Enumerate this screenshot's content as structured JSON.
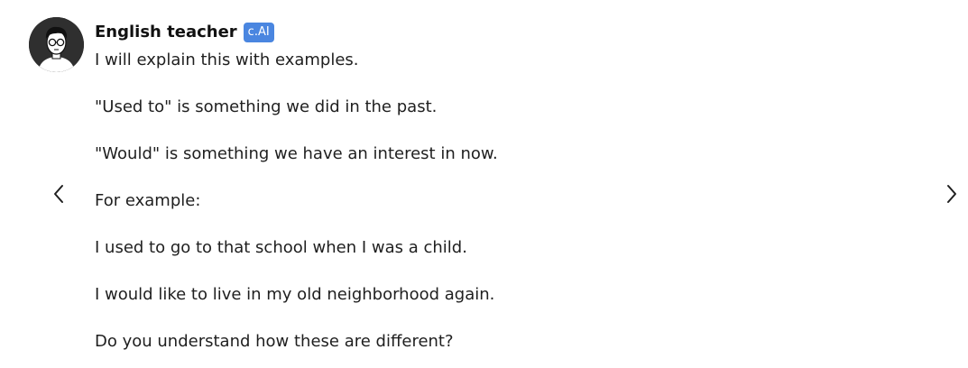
{
  "character": {
    "name": "English teacher",
    "badge": "c.AI",
    "avatar_icon": "man-with-glasses-avatar"
  },
  "message": {
    "lines": [
      "I will explain this with examples.",
      "\"Used to\" is something we did in the past.",
      "\"Would\" is something we have an interest in now.",
      "For example:",
      "I used to go to that school when I was a child.",
      "I would like to live in my old neighborhood again.",
      "Do you understand how these are different?"
    ]
  },
  "navigation": {
    "prev_icon": "chevron-left-icon",
    "next_icon": "chevron-right-icon"
  },
  "colors": {
    "badge_background": "#4a86e0",
    "text": "#1f1f1f",
    "background": "#ffffff"
  }
}
